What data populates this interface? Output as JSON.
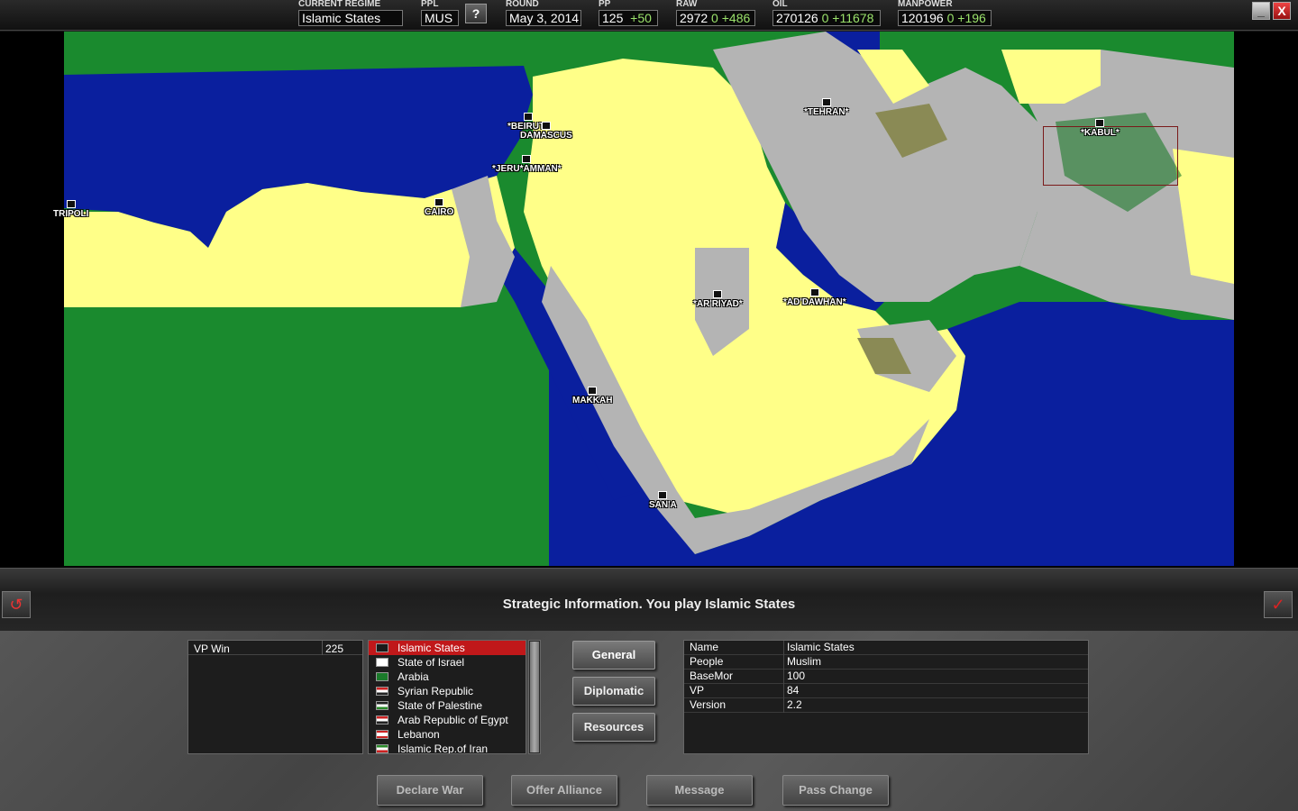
{
  "topbar": {
    "regime_label": "CURRENT REGIME",
    "regime_value": "Islamic States",
    "ppl_label": "PPL",
    "ppl_value": "MUS",
    "help_label": "?",
    "round_label": "ROUND",
    "round_value": "May 3, 2014",
    "pp_label": "PP",
    "pp_value": "125",
    "pp_delta": "+50",
    "raw_label": "RAW",
    "raw_value": "2972",
    "raw_mid": "0",
    "raw_delta": "+486",
    "oil_label": "OIL",
    "oil_value": "270126",
    "oil_mid": "0",
    "oil_delta": "+11678",
    "manpower_label": "MANPOWER",
    "manpower_value": "120196",
    "manpower_mid": "0",
    "manpower_delta": "+196",
    "minimize_icon": "_",
    "close_icon": "X"
  },
  "map": {
    "cities": {
      "tripoli": "TRIPOLI",
      "cairo": "CAIRO",
      "beirut": "*BEIRUT*",
      "damascus": "DAMASCUS",
      "jerusalem_amman": "*JERU*AMMAN*",
      "tehran": "*TEHRAN*",
      "kabul": "*KABUL*",
      "riyadh": "*AR'RIYAD*",
      "doha": "*AD'DAWHAN*",
      "makkah": "MAKKAH",
      "sana": "SAN'A"
    }
  },
  "panel": {
    "title": "Strategic Information. You play Islamic States",
    "back_icon": "↺",
    "ok_icon": "✓"
  },
  "vp": {
    "label": "VP Win",
    "value": "225"
  },
  "nations": [
    {
      "name": "Islamic States",
      "flag": "#1a1a1a"
    },
    {
      "name": "State of Israel",
      "flag": "#ffffff"
    },
    {
      "name": "Arabia",
      "flag": "#1a7a2a"
    },
    {
      "name": "Syrian Republic",
      "flag": "#cc2222"
    },
    {
      "name": "State of Palestine",
      "flag": "#222222"
    },
    {
      "name": "Arab Republic of Egypt",
      "flag": "#cc2222"
    },
    {
      "name": "Lebanon",
      "flag": "#cc2222"
    },
    {
      "name": "Islamic Rep.of Iran",
      "flag": "#2a8a2a"
    }
  ],
  "side_buttons": {
    "general": "General",
    "diplomatic": "Diplomatic",
    "resources": "Resources"
  },
  "info": [
    {
      "key": "Name",
      "value": "Islamic States"
    },
    {
      "key": "People",
      "value": "Muslim"
    },
    {
      "key": "BaseMor",
      "value": "100"
    },
    {
      "key": "VP",
      "value": "84"
    },
    {
      "key": "Version",
      "value": "2.2"
    }
  ],
  "actions": {
    "declare_war": "Declare War",
    "offer_alliance": "Offer Alliance",
    "message": "Message",
    "pass_change": "Pass Change"
  },
  "colors": {
    "sea": "#0a1f9e",
    "neutral": "#1a8a2e",
    "player": "#ffff88",
    "enemy": "#b4b4b4",
    "selected_row": "#c0181a"
  }
}
